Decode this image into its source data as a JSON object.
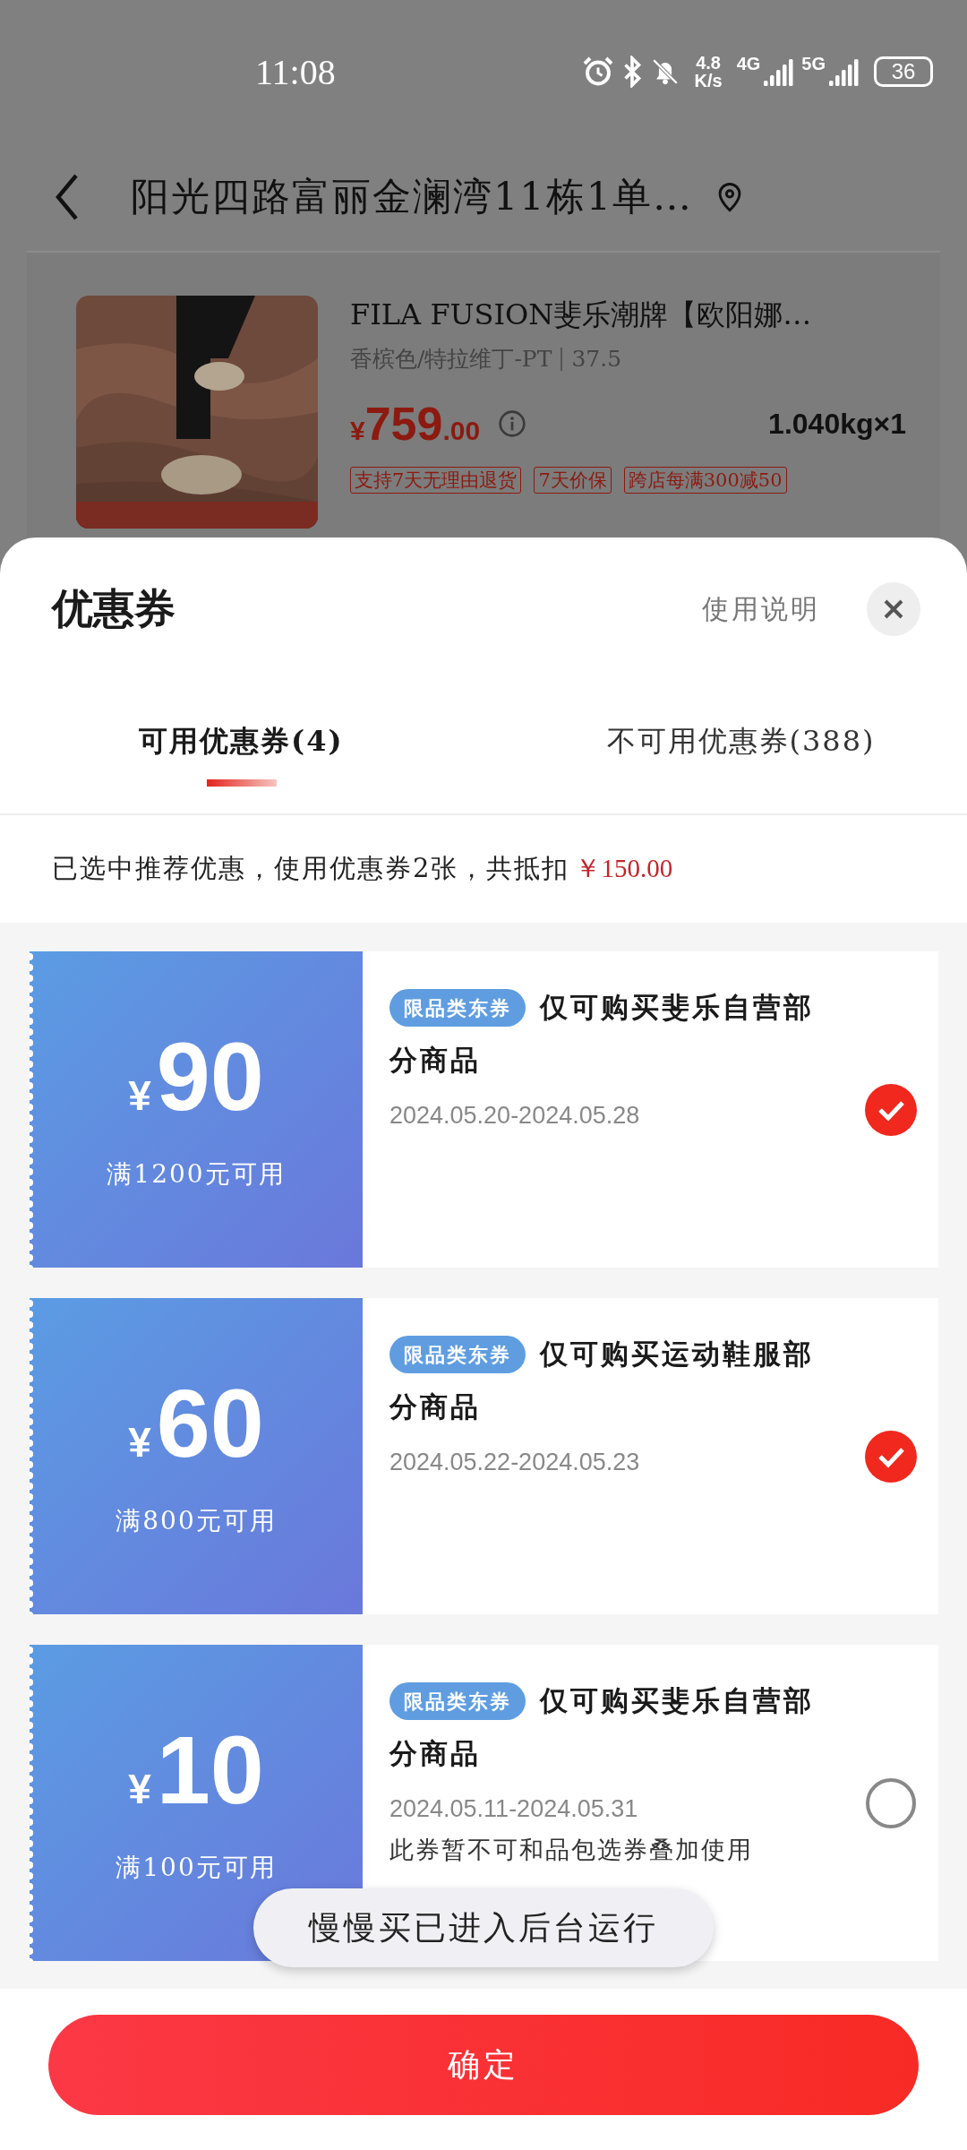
{
  "status_bar": {
    "time": "11:08",
    "speed": [
      "4.8",
      "K/s"
    ],
    "networks": [
      "4G",
      "5G"
    ],
    "battery": "36"
  },
  "header": {
    "address": "阳光四路富丽金澜湾11栋1单…"
  },
  "product": {
    "title": "FILA FUSION斐乐潮牌【欧阳娜…",
    "spec": "香槟色/特拉维丁-PT",
    "size": "37.5",
    "price_symbol": "¥",
    "price_int": "759",
    "price_dec": ".00",
    "weight": "1.040kg×1",
    "tags": [
      "支持7天无理由退货",
      "7天价保",
      "跨店每满300减50"
    ]
  },
  "sheet": {
    "title": "优惠券",
    "help_link": "使用说明",
    "tabs": [
      {
        "label": "可用优惠券(4)",
        "selected": true
      },
      {
        "label": "不可用优惠券(388)",
        "selected": false
      }
    ],
    "summary": {
      "text": "已选中推荐优惠，使用优惠券2张，共抵扣",
      "amount": "￥150.00"
    },
    "coupons": [
      {
        "symbol": "¥",
        "amount": "90",
        "condition": "满1200元可用",
        "tag": "限品类东券",
        "title_lines": [
          "仅可购买斐乐自营部",
          "分商品"
        ],
        "period": "2024.05.20-2024.05.28",
        "selected": true
      },
      {
        "symbol": "¥",
        "amount": "60",
        "condition": "满800元可用",
        "tag": "限品类东券",
        "title_lines": [
          "仅可购买运动鞋服部",
          "分商品"
        ],
        "period": "2024.05.22-2024.05.23",
        "selected": true
      },
      {
        "symbol": "¥",
        "amount": "10",
        "condition": "满100元可用",
        "tag": "限品类东券",
        "title_lines": [
          "仅可购买斐乐自营部",
          "分商品"
        ],
        "period": "2024.05.11-2024.05.31",
        "note": "此券暂不可和品包选券叠加使用",
        "selected": false
      }
    ],
    "confirm": "确定"
  },
  "toast": "慢慢买已进入后台运行"
}
